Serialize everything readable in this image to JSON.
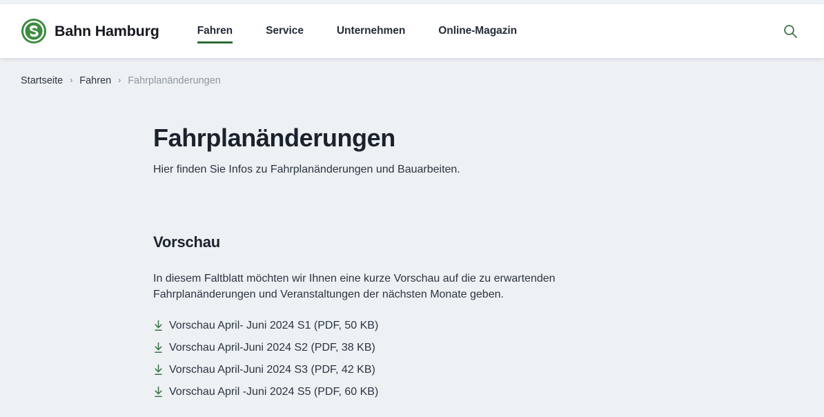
{
  "colors": {
    "brand_green": "#3d8c40",
    "accent_green": "#2d6b33",
    "page_background": "#edf1f4",
    "header_background": "#ffffff",
    "text": "#2b3440",
    "muted_text": "#8e979f"
  },
  "header": {
    "logo_icon": "s-bahn-logo-icon",
    "brand_name": "Bahn Hamburg",
    "nav": [
      {
        "label": "Fahren",
        "active": true
      },
      {
        "label": "Service",
        "active": false
      },
      {
        "label": "Unternehmen",
        "active": false
      },
      {
        "label": "Online-Magazin",
        "active": false
      }
    ],
    "search_icon": "search-icon"
  },
  "breadcrumb": {
    "separator": "›",
    "items": [
      {
        "label": "Startseite",
        "current": false
      },
      {
        "label": "Fahren",
        "current": false
      },
      {
        "label": "Fahrplanänderungen",
        "current": true
      }
    ]
  },
  "main": {
    "title": "Fahrplanänderungen",
    "subtitle": "Hier finden Sie Infos zu Fahrplanänderungen und Bauarbeiten.",
    "section": {
      "title": "Vorschau",
      "body": "In diesem Faltblatt möchten wir Ihnen eine kurze Vorschau auf die zu erwartenden Fahrplanänderungen und Veranstaltungen der nächsten Monate geben.",
      "downloads": [
        {
          "icon": "download-icon",
          "label": "Vorschau April- Juni 2024 S1 (PDF, 50 KB)"
        },
        {
          "icon": "download-icon",
          "label": "Vorschau April-Juni 2024 S2 (PDF, 38 KB)"
        },
        {
          "icon": "download-icon",
          "label": "Vorschau April-Juni 2024 S3 (PDF, 42 KB)"
        },
        {
          "icon": "download-icon",
          "label": "Vorschau April -Juni 2024 S5 (PDF, 60 KB)"
        }
      ]
    }
  }
}
